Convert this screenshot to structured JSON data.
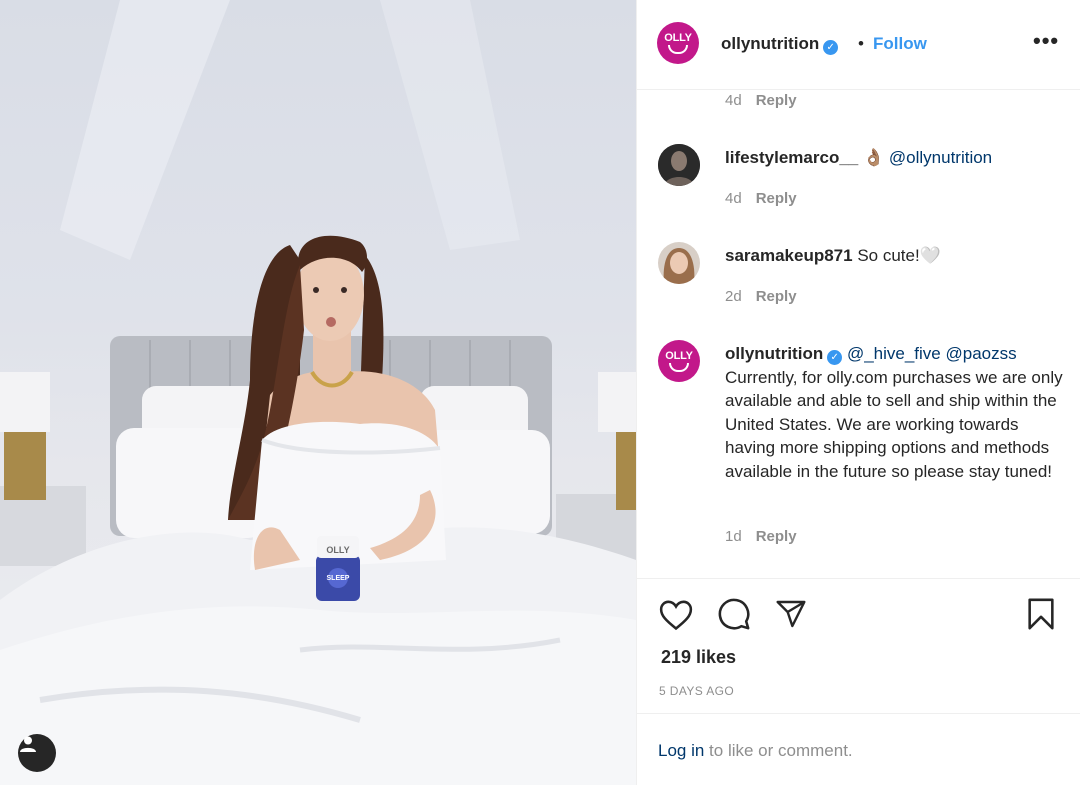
{
  "post": {
    "likes": "219 likes",
    "date": "5 DAYS AGO"
  },
  "header": {
    "username": "ollynutrition",
    "separator": "•",
    "follow": "Follow",
    "more": "•••",
    "logo_text": "OLLY"
  },
  "product_label": {
    "brand": "OLLY",
    "name": "SLEEP"
  },
  "comments": [
    {
      "time": "4d",
      "reply": "Reply"
    },
    {
      "username": "lifestylemarco__",
      "emoji": "👌🏽",
      "mention": "@ollynutrition",
      "time": "4d",
      "reply": "Reply"
    },
    {
      "username": "saramakeup871",
      "text": "So cute!🤍",
      "time": "2d",
      "reply": "Reply"
    },
    {
      "username": "ollynutrition",
      "mention1": "@_hive_five",
      "mention2": "@paozss",
      "text": "Currently, for olly.com purchases we are only available and able to sell and ship within the United States. We are working towards having more shipping options and methods available in the future so please stay tuned!",
      "time": "1d",
      "reply": "Reply",
      "logo_text": "OLLY"
    }
  ],
  "footer": {
    "login": "Log in",
    "rest": " to like or comment."
  },
  "icons": {
    "like": "heart-icon",
    "comment": "comment-icon",
    "share": "send-icon",
    "save": "bookmark-icon",
    "user_tag": "user-icon"
  },
  "colors": {
    "brand": "#c2188a",
    "link": "#3897f0",
    "mention": "#00376b",
    "muted": "#8e8e8e"
  }
}
